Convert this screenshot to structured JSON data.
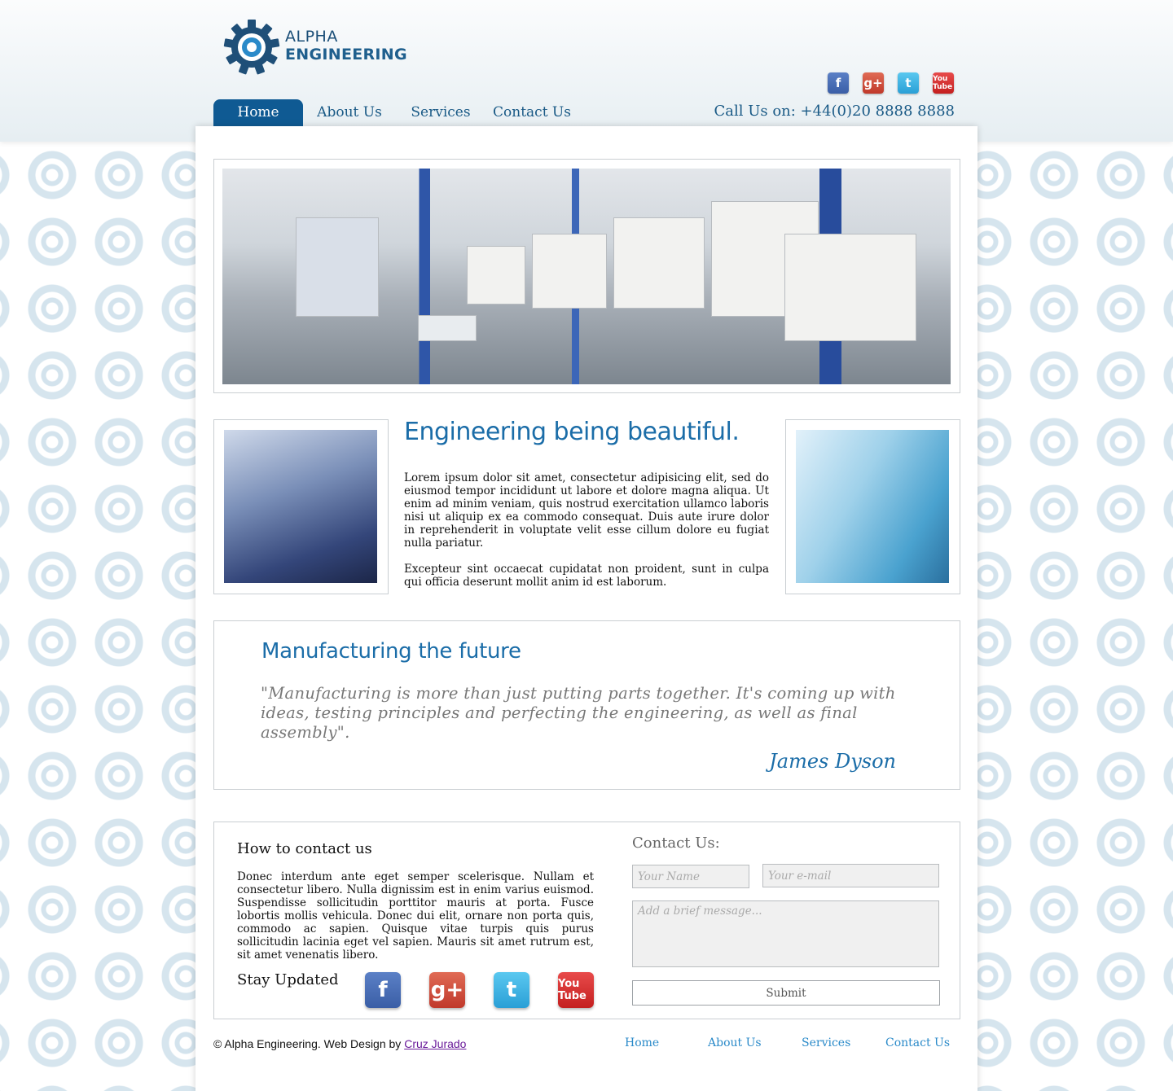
{
  "brand": {
    "line1": "ALPHA",
    "line2": "ENGINEERING"
  },
  "header": {
    "social": [
      "f",
      "g+",
      "t",
      "You Tube"
    ],
    "call_us": "Call Us on: +44(0)20 8888 8888"
  },
  "nav": {
    "items": [
      "Home",
      "About Us",
      "Services",
      "Contact Us"
    ],
    "active": "Home"
  },
  "feature": {
    "title": "Engineering being beautiful.",
    "p1": "Lorem ipsum dolor sit amet, consectetur adipisicing elit, sed do eiusmod tempor incididunt ut labore et dolore magna aliqua. Ut enim ad minim veniam, quis nostrud exercitation ullamco laboris nisi ut aliquip ex ea commodo consequat. Duis aute irure dolor in reprehenderit in voluptate velit esse cillum dolore eu fugiat nulla pariatur.",
    "p2": "Excepteur sint occaecat cupidatat non proident, sunt in culpa qui officia deserunt mollit anim id est laborum."
  },
  "quote": {
    "title": "Manufacturing the future",
    "text": "\"Manufacturing is more than just putting parts together. It's coming up with ideas, testing principles and perfecting the engineering, as well as final assembly\".",
    "author": "James Dyson"
  },
  "contact": {
    "heading": "How to contact us",
    "text": "Donec interdum ante eget semper scelerisque. Nullam et consectetur libero. Nulla dignissim est in enim varius euismod. Suspendisse sollicitudin porttitor mauris at porta. Fusce lobortis mollis vehicula. Donec dui elit, ornare non porta quis, commodo ac sapien. Quisque vitae turpis quis purus sollicitudin lacinia eget vel sapien. Mauris sit amet rutrum est, sit amet venenatis libero.",
    "stay_updated": "Stay Updated",
    "social": [
      "f",
      "g+",
      "t",
      "You Tube"
    ]
  },
  "form": {
    "title": "Contact Us:",
    "name_placeholder": "Your Name",
    "email_placeholder": "Your e-mail",
    "message_placeholder": "Add a brief message...",
    "submit_label": "Submit"
  },
  "footer": {
    "copyright": "© Alpha Engineering. Web Design by ",
    "designer": "Cruz Jurado",
    "nav": [
      "Home",
      "About Us",
      "Services",
      "Contact Us"
    ]
  },
  "colors": {
    "accent": "#0f5a93",
    "heading_blue": "#1b6da8",
    "footer_link": "#2a8ac9"
  }
}
